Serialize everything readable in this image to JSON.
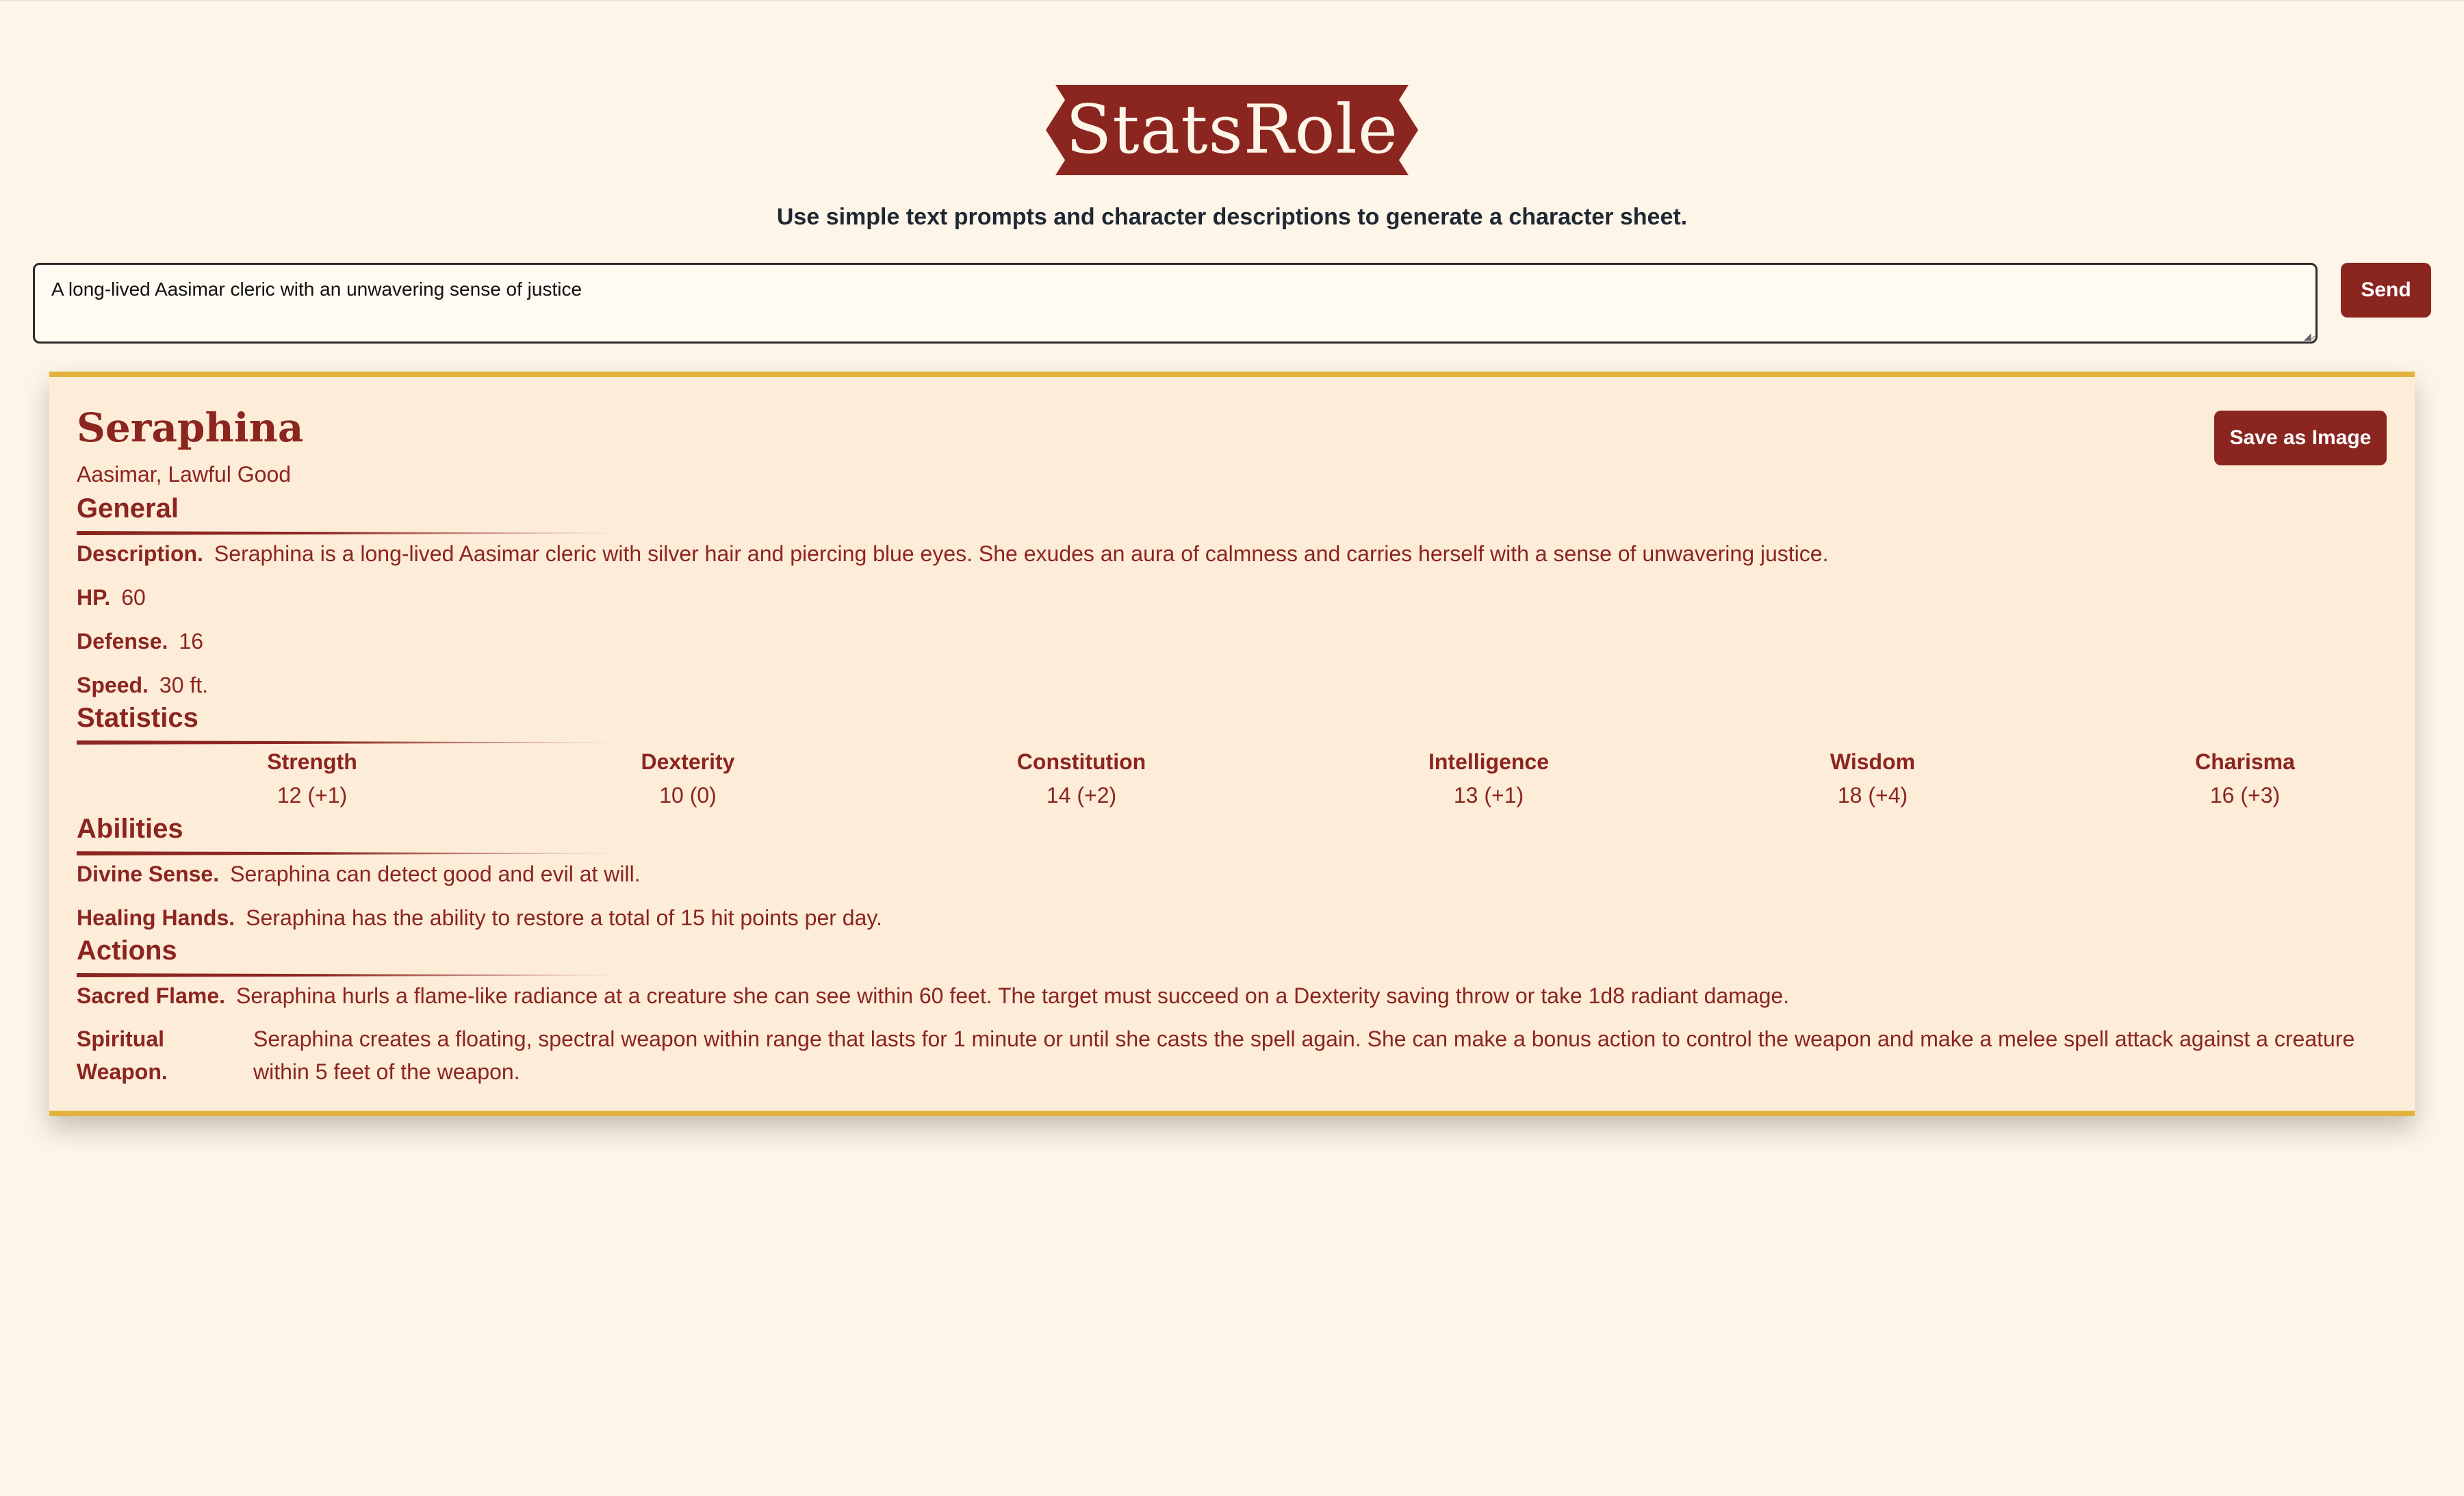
{
  "app": {
    "title": "StatsRole",
    "subtitle": "Use simple text prompts and character descriptions to generate a character sheet.",
    "brand_color": "#8b2520",
    "accent_color": "#e2b23d",
    "background_color": "#fdf5e8"
  },
  "prompt": {
    "value": "A long-lived Aasimar cleric with an unwavering sense of justice",
    "send_label": "Send"
  },
  "sheet": {
    "name": "Seraphina",
    "race_alignment": "Aasimar, Lawful Good",
    "save_label": "Save as Image",
    "general": {
      "heading": "General",
      "description_label": "Description.",
      "description": "Seraphina is a long-lived Aasimar cleric with silver hair and piercing blue eyes. She exudes an aura of calmness and carries herself with a sense of unwavering justice.",
      "hp_label": "HP.",
      "hp": "60",
      "defense_label": "Defense.",
      "defense": "16",
      "speed_label": "Speed.",
      "speed": "30 ft."
    },
    "statistics": {
      "heading": "Statistics",
      "items": [
        {
          "name": "Strength",
          "value": "12 (+1)"
        },
        {
          "name": "Dexterity",
          "value": "10 (0)"
        },
        {
          "name": "Constitution",
          "value": "14 (+2)"
        },
        {
          "name": "Intelligence",
          "value": "13 (+1)"
        },
        {
          "name": "Wisdom",
          "value": "18 (+4)"
        },
        {
          "name": "Charisma",
          "value": "16 (+3)"
        }
      ]
    },
    "abilities": {
      "heading": "Abilities",
      "items": [
        {
          "name": "Divine Sense.",
          "text": "Seraphina can detect good and evil at will."
        },
        {
          "name": "Healing Hands.",
          "text": "Seraphina has the ability to restore a total of 15 hit points per day."
        }
      ]
    },
    "actions": {
      "heading": "Actions",
      "items": [
        {
          "name": "Sacred Flame.",
          "text": "Seraphina hurls a flame-like radiance at a creature she can see within 60 feet. The target must succeed on a Dexterity saving throw or take 1d8 radiant damage."
        },
        {
          "name": "Spiritual Weapon.",
          "text": "Seraphina creates a floating, spectral weapon within range that lasts for 1 minute or until she casts the spell again. She can make a bonus action to control the weapon and make a melee spell attack against a creature within 5 feet of the weapon."
        }
      ]
    }
  }
}
